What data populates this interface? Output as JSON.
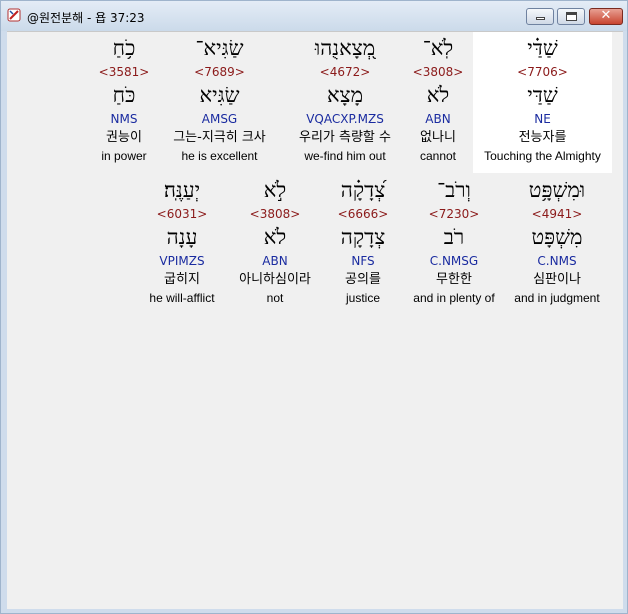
{
  "window": {
    "title": "@원전분해 - 욥 37:23"
  },
  "words": [
    {
      "hebrew": "שַׁדַּ֗י",
      "strong": "<7706>",
      "lemma": "שַׁדַּי",
      "parse": "NE",
      "korean": "전능자를",
      "english": "Touching the Almighty"
    },
    {
      "hebrew": "לֹֽא־",
      "strong": "<3808>",
      "lemma": "לֹא",
      "parse": "ABN",
      "korean": "없나니",
      "english": "cannot"
    },
    {
      "hebrew": "מְ֭צָאנֻהוּ",
      "strong": "<4672>",
      "lemma": "מָצָא",
      "parse": "VQACXP.MZS",
      "korean": "우리가 측량할 수",
      "english": "we-find him out"
    },
    {
      "hebrew": "שַׂגִּיא־",
      "strong": "<7689>",
      "lemma": "שַׂגִּיא",
      "parse": "AMSG",
      "korean": "그는-지극히 크사",
      "english": "he is excellent"
    },
    {
      "hebrew": "כֹ֥חַ",
      "strong": "<3581>",
      "lemma": "כֹּחַ",
      "parse": "NMS",
      "korean": "권능이",
      "english": "in power"
    },
    {
      "hebrew": "וּמִשְׁפָּ֥ט",
      "strong": "<4941>",
      "lemma": "מִשְׁפָּט",
      "parse": "C.NMS",
      "korean": "심판이나",
      "english": "and in judgment"
    },
    {
      "hebrew": "וְרֹב־",
      "strong": "<7230>",
      "lemma": "רֹב",
      "parse": "C.NMSG",
      "korean": "무한한",
      "english": "and in plenty of"
    },
    {
      "hebrew": "צְ֝דָקָ֗ה",
      "strong": "<6666>",
      "lemma": "צְדָקָה",
      "parse": "NFS",
      "korean": "공의를",
      "english": "justice"
    },
    {
      "hebrew": "לֹ֣א",
      "strong": "<3808>",
      "lemma": "לֹא",
      "parse": "ABN",
      "korean": "아니하심이라",
      "english": "not"
    },
    {
      "hebrew": "יְעַנֶּֽה׃",
      "strong": "<6031>",
      "lemma": "עָנָה",
      "parse": "VPIMZS",
      "korean": "굽히지",
      "english": "he will-afflict"
    }
  ]
}
